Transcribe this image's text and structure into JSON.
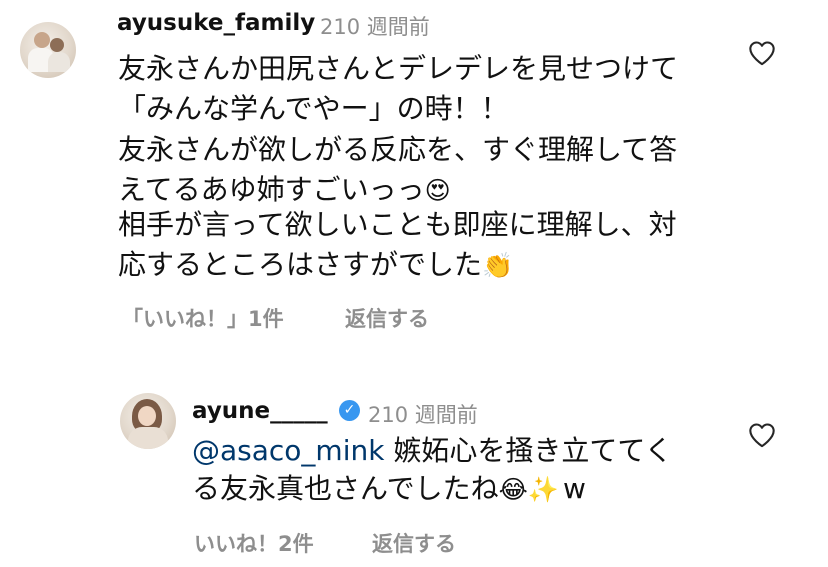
{
  "comment": {
    "username": "ayusuke_family",
    "time": "210 週間前",
    "lines": [
      "友永さんか田尻さんとデレデレを見せつけて",
      "「みんな学んでやー」の時！！",
      "友永さんが欲しがる反応を、すぐ理解して答",
      "えてるあゆ姉すごいっっ",
      "相手が言って欲しいことも即座に理解し、対",
      "応するところはさすがでした"
    ],
    "emoji_heart_eyes": "😍",
    "emoji_clap": "👏",
    "likes": "「いいね！」1件",
    "reply": "返信する"
  },
  "reply": {
    "username": "ayune_____",
    "time": "210 週間前",
    "mention": "@asaco_mink",
    "line1_rest": " 嫉妬心を掻き立ててく",
    "line2": "る友永真也さんでしたね",
    "emoji_laugh": "😂",
    "emoji_sparkles": "✨",
    "tail": "w",
    "likes": "いいね！2件",
    "reply_action": "返信する"
  },
  "icons": [
    "avatar",
    "heart-outline-icon",
    "verified-badge-icon"
  ]
}
